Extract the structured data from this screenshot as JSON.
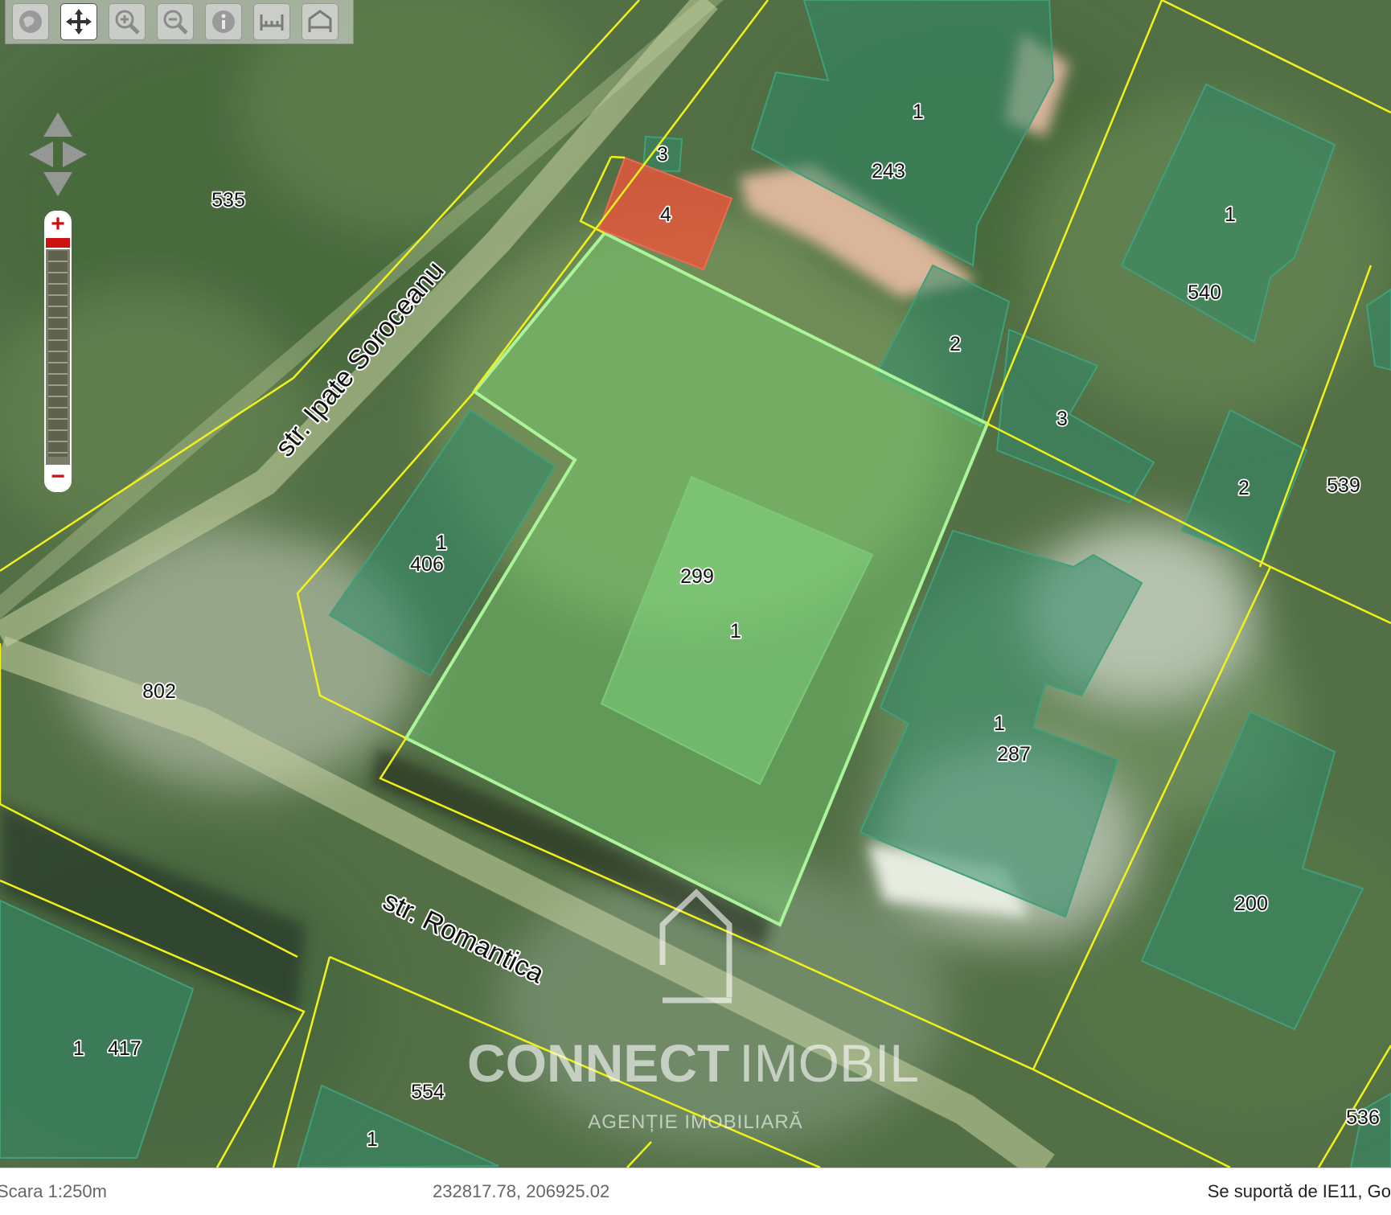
{
  "toolbar": {
    "tools": [
      {
        "name": "globe-icon"
      },
      {
        "name": "pan-icon",
        "active": true
      },
      {
        "name": "zoom-in-icon"
      },
      {
        "name": "zoom-out-icon"
      },
      {
        "name": "info-icon"
      },
      {
        "name": "measure-icon"
      },
      {
        "name": "measure-area-icon"
      }
    ]
  },
  "zoom": {
    "plus": "+",
    "minus": "−"
  },
  "map": {
    "colors": {
      "parcel_border": "#f2f21a",
      "building_fill": "#2f8a6a",
      "selected_fill": "#7de07a",
      "selected_border": "#aaf59a",
      "highlight_fill": "#e8553a"
    },
    "streets": {
      "ipate": "str. Ipate Soroceanu",
      "romantica": "str. Romantica"
    },
    "labels": {
      "p535": "535",
      "p802": "802",
      "p243": "243",
      "b243": "1",
      "b3top": "3",
      "b4": "4",
      "p406": "406",
      "b406": "1",
      "p299": "299",
      "b299": "1",
      "b2mid": "2",
      "b3mid": "3",
      "p540": "540",
      "b540": "1",
      "b2right": "2",
      "p539": "539",
      "p287": "287",
      "b287": "1",
      "p200": "200",
      "p417": "417",
      "b417": "1",
      "p554": "554",
      "b554": "1",
      "p536": "536"
    }
  },
  "watermark": {
    "brand_bold": "CONNECT",
    "brand_light": "IMOBIL",
    "tagline": "AGENȚIE IMOBILIARĂ"
  },
  "status": {
    "scale": "Scara 1:250m",
    "coords": "232817.78, 206925.02",
    "support": "Se suportă de IE11, Go"
  }
}
